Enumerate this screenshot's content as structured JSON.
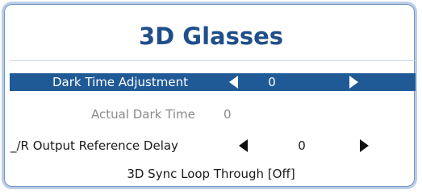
{
  "panel": {
    "title": "3D Glasses"
  },
  "menu": {
    "dark_time": {
      "label": "Dark Time Adjustment",
      "value": "0"
    },
    "actual_dark_time": {
      "label": "Actual Dark Time",
      "value": "0"
    },
    "lr_delay": {
      "label": "_/R Output Reference Delay",
      "value": "0"
    },
    "sync_loop": {
      "label": "3D Sync Loop Through [Off]"
    }
  },
  "colors": {
    "title": "#1f4f8a",
    "selected_bg": "#1f5a97",
    "panel_border": "#b9cde6",
    "disabled_text": "#8a8a8a"
  },
  "icons": [
    "arrow-left-icon",
    "arrow-right-icon"
  ]
}
